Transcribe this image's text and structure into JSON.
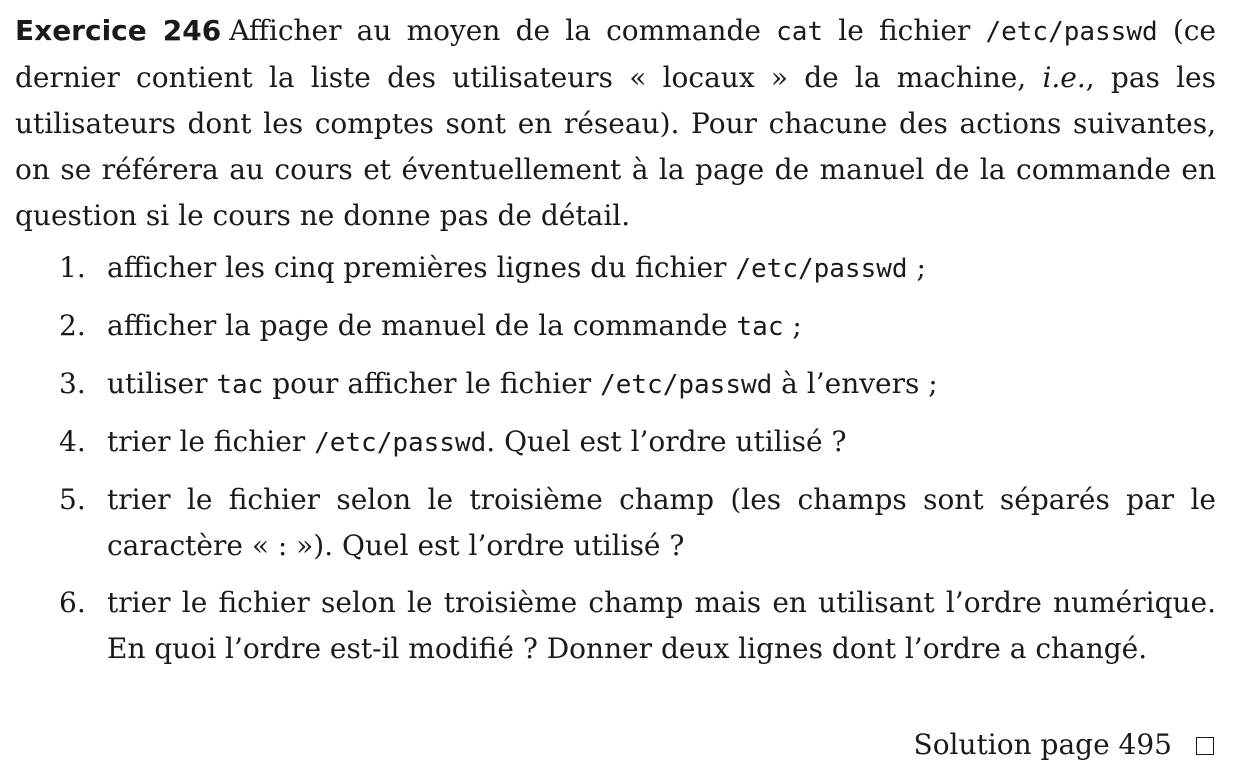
{
  "exercise": {
    "heading": "Exercice 246",
    "intro": [
      {
        "t": "Afficher au moyen de la commande "
      },
      {
        "t": "cat",
        "mono": true
      },
      {
        "t": " le fichier "
      },
      {
        "t": "/etc/passwd",
        "mono": true
      },
      {
        "t": " (ce dernier contient la liste des utilisateurs « locaux » de la machine, "
      },
      {
        "t": "i.e.",
        "italic": true
      },
      {
        "t": ", pas les utilisateurs dont les comptes sont en réseau). Pour chacune des actions suivantes, on se référera au cours et éventuellement à la page de manuel de la commande en question si le cours ne donne pas de détail."
      }
    ],
    "items": [
      {
        "number": "1.",
        "parts": [
          {
            "t": "afficher les cinq premières lignes du fichier "
          },
          {
            "t": "/etc/passwd",
            "mono": true
          },
          {
            "t": " ;"
          }
        ]
      },
      {
        "number": "2.",
        "parts": [
          {
            "t": "afficher la page de manuel de la commande "
          },
          {
            "t": "tac",
            "mono": true
          },
          {
            "t": " ;"
          }
        ]
      },
      {
        "number": "3.",
        "parts": [
          {
            "t": "utiliser "
          },
          {
            "t": "tac",
            "mono": true
          },
          {
            "t": " pour afficher le fichier "
          },
          {
            "t": "/etc/passwd",
            "mono": true
          },
          {
            "t": " à l’envers ;"
          }
        ]
      },
      {
        "number": "4.",
        "parts": [
          {
            "t": "trier le fichier "
          },
          {
            "t": "/etc/passwd",
            "mono": true
          },
          {
            "t": ". Quel est l’ordre utilisé ?"
          }
        ]
      },
      {
        "number": "5.",
        "parts": [
          {
            "t": "trier le fichier selon le troisième champ (les champs sont séparés par le caractère «  : »). Quel est l’ordre utilisé ?"
          }
        ]
      },
      {
        "number": "6.",
        "parts": [
          {
            "t": "trier le fichier selon le troisième champ mais en utilisant l’ordre numérique. En quoi l’ordre est-il modifié ? Donner deux lignes dont l’ordre a changé."
          }
        ]
      }
    ],
    "solution": "Solution page 495"
  }
}
